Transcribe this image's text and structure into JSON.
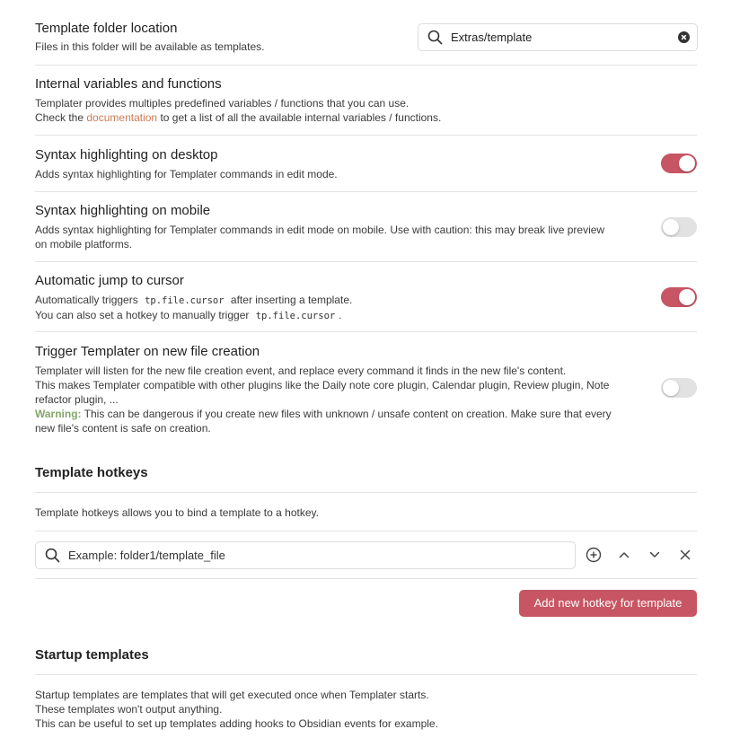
{
  "settings": {
    "template_folder": {
      "name": "Template folder location",
      "desc": "Files in this folder will be available as templates.",
      "value": "Extras/template"
    },
    "internal_vars": {
      "name": "Internal variables and functions",
      "line1": "Templater provides multiples predefined variables / functions that you can use.",
      "line2_pre": "Check the",
      "link": "documentation",
      "line2_post": "to get a list of all the available internal variables / functions."
    },
    "syntax_desktop": {
      "name": "Syntax highlighting on desktop",
      "desc": "Adds syntax highlighting for Templater commands in edit mode.",
      "enabled": true
    },
    "syntax_mobile": {
      "name": "Syntax highlighting on mobile",
      "desc_line1": "Adds syntax highlighting for Templater commands in edit mode on mobile. Use with caution: this may break live preview",
      "desc_line2": "on mobile platforms.",
      "enabled": false
    },
    "auto_jump": {
      "name": "Automatic jump to cursor",
      "line1_pre": "Automatically triggers",
      "code1": "tp.file.cursor",
      "line1_post": "after inserting a template.",
      "line2_pre": "You can also set a hotkey to manually trigger",
      "code2": "tp.file.cursor",
      "line2_post": ".",
      "enabled": true
    },
    "trigger_new_file": {
      "name": "Trigger Templater on new file creation",
      "line1": "Templater will listen for the new file creation event, and replace every command it finds in the new file's content.",
      "line2": "This makes Templater compatible with other plugins like the Daily note core plugin, Calendar plugin, Review plugin, Note",
      "line3": "refactor plugin, ...",
      "warning_label": "Warning:",
      "warning_text": "This can be dangerous if you create new files with unknown / unsafe content on creation. Make sure that every",
      "line5": "new file's content is safe on creation.",
      "enabled": false
    }
  },
  "hotkeys": {
    "heading": "Template hotkeys",
    "desc": "Template hotkeys allows you to bind a template to a hotkey.",
    "search_placeholder": "Example: folder1/template_file",
    "add_button": "Add new hotkey for template",
    "icons": [
      "plus-circle-icon",
      "chevron-up-icon",
      "chevron-down-icon",
      "close-icon"
    ]
  },
  "startup": {
    "heading": "Startup templates",
    "line1": "Startup templates are templates that will get executed once when Templater starts.",
    "line2": "These templates won't output anything.",
    "line3": "This can be useful to set up templates adding hooks to Obsidian events for example."
  },
  "colors": {
    "accent": "#c75563",
    "link": "#d07a55",
    "warning": "#84a56a"
  }
}
